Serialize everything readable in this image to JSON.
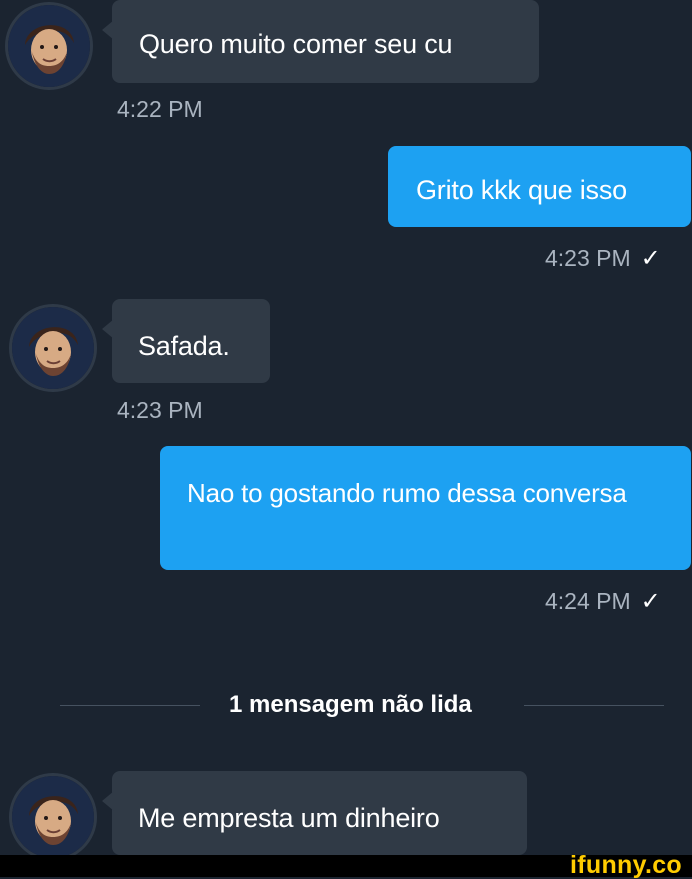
{
  "messages": [
    {
      "type": "incoming",
      "text": "Quero muito comer seu cu",
      "time": "4:22 PM"
    },
    {
      "type": "outgoing",
      "text": "Grito kkk que isso",
      "time": "4:23 PM",
      "status": "✓"
    },
    {
      "type": "incoming",
      "text": "Safada.",
      "time": "4:23 PM"
    },
    {
      "type": "outgoing",
      "text": "Nao to gostando rumo dessa conversa",
      "time": "4:24 PM",
      "status": "✓"
    },
    {
      "type": "incoming",
      "text": "Me empresta um dinheiro"
    }
  ],
  "unread_divider": "1 mensagem não lida",
  "watermark": "ifunny.co",
  "colors": {
    "background": "#1b2430",
    "incoming_bubble": "#303a46",
    "outgoing_bubble": "#1da1f2",
    "timestamp": "#aab4c0",
    "watermark": "#ffcc00"
  }
}
